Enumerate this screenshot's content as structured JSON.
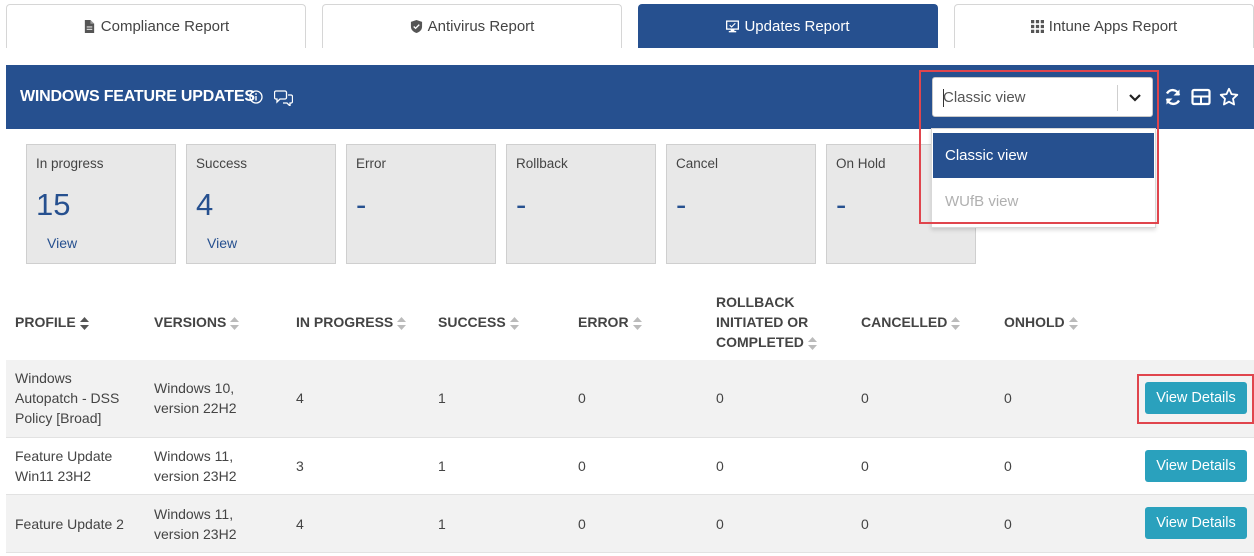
{
  "tabs": [
    {
      "label": "Compliance Report",
      "icon": "document-icon",
      "active": false
    },
    {
      "label": "Antivirus Report",
      "icon": "shield-icon",
      "active": false
    },
    {
      "label": "Updates Report",
      "icon": "monitor-icon",
      "active": true
    },
    {
      "label": "Intune Apps Report",
      "icon": "grid-icon",
      "active": false
    }
  ],
  "header": {
    "title": "WINDOWS FEATURE UPDATES",
    "view_select": {
      "value": "Classic view"
    },
    "icons": [
      "refresh-icon",
      "table-layout-icon",
      "star-icon"
    ]
  },
  "dropdown": {
    "options": [
      {
        "label": "Classic view",
        "selected": true
      },
      {
        "label": "WUfB view",
        "selected": false,
        "disabled": true
      }
    ]
  },
  "stats": [
    {
      "label": "In progress",
      "value": "15",
      "link": "View"
    },
    {
      "label": "Success",
      "value": "4",
      "link": "View"
    },
    {
      "label": "Error",
      "value": "-",
      "link": ""
    },
    {
      "label": "Rollback",
      "value": "-",
      "link": ""
    },
    {
      "label": "Cancel",
      "value": "-",
      "link": ""
    },
    {
      "label": "On Hold",
      "value": "-",
      "link": ""
    }
  ],
  "table": {
    "columns": [
      "PROFILE",
      "VERSIONS",
      "IN PROGRESS",
      "SUCCESS",
      "ERROR",
      "ROLLBACK INITIATED OR COMPLETED",
      "CANCELLED",
      "ONHOLD"
    ],
    "rollback_lines": [
      "ROLLBACK",
      "INITIATED OR",
      "COMPLETED"
    ],
    "rows": [
      {
        "profile": [
          "Windows",
          "Autopatch - DSS",
          "Policy [Broad]"
        ],
        "versions": [
          "Windows 10,",
          "version 22H2"
        ],
        "in_progress": "4",
        "success": "1",
        "error": "0",
        "rollback": "0",
        "cancelled": "0",
        "onhold": "0",
        "action": "View Details"
      },
      {
        "profile": [
          "Feature Update",
          "Win11 23H2"
        ],
        "versions": [
          "Windows 11,",
          "version 23H2"
        ],
        "in_progress": "3",
        "success": "1",
        "error": "0",
        "rollback": "0",
        "cancelled": "0",
        "onhold": "0",
        "action": "View Details"
      },
      {
        "profile": [
          "Feature Update 2"
        ],
        "versions": [
          "Windows 11,",
          "version 23H2"
        ],
        "in_progress": "4",
        "success": "1",
        "error": "0",
        "rollback": "0",
        "cancelled": "0",
        "onhold": "0",
        "action": "View Details"
      }
    ]
  },
  "colors": {
    "primary": "#26508f",
    "button": "#2aa1bd",
    "highlight": "#e0454d",
    "card": "#e8e8e8",
    "row_alt": "#f2f2f2"
  }
}
